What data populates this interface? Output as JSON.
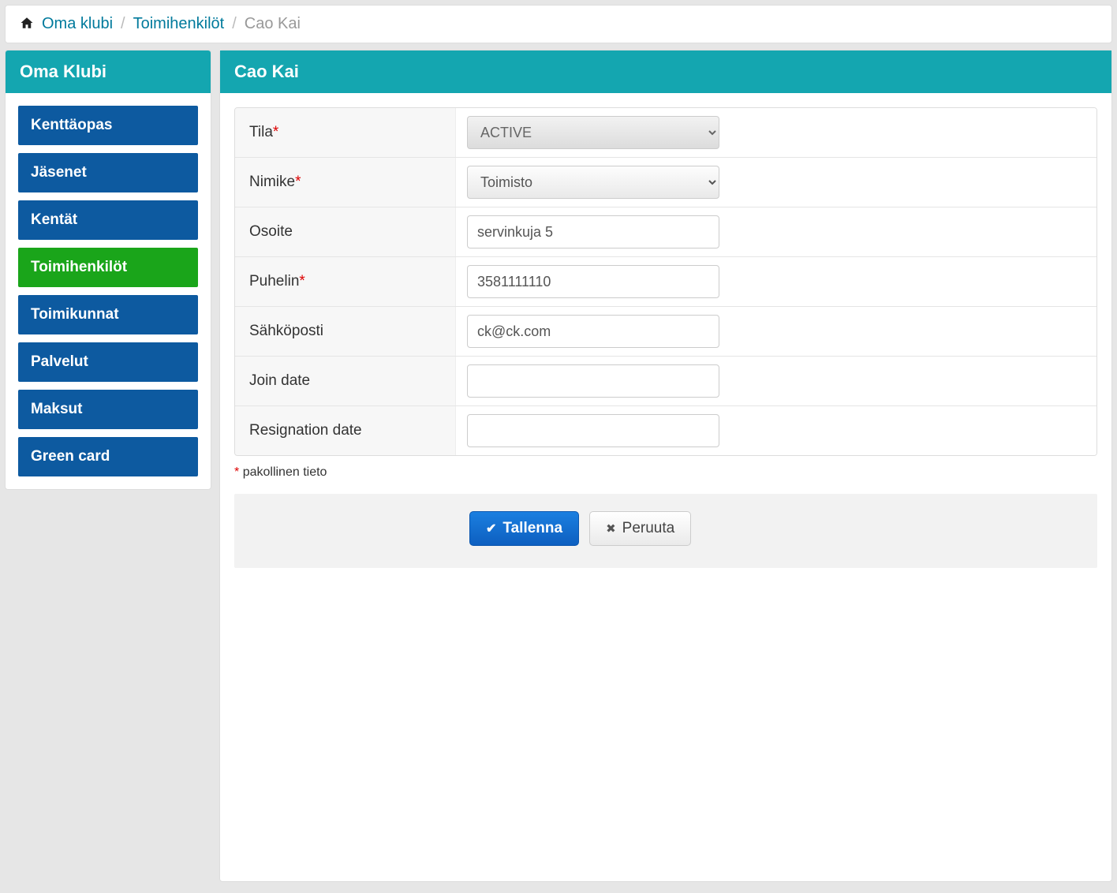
{
  "breadcrumb": {
    "items": [
      {
        "label": "Oma klubi",
        "link": true
      },
      {
        "label": "Toimihenkilöt",
        "link": true
      },
      {
        "label": "Cao Kai",
        "link": false
      }
    ]
  },
  "sidebar": {
    "title": "Oma Klubi",
    "items": [
      {
        "label": "Kenttäopas",
        "active": false
      },
      {
        "label": "Jäsenet",
        "active": false
      },
      {
        "label": "Kentät",
        "active": false
      },
      {
        "label": "Toimihenkilöt",
        "active": true
      },
      {
        "label": "Toimikunnat",
        "active": false
      },
      {
        "label": "Palvelut",
        "active": false
      },
      {
        "label": "Maksut",
        "active": false
      },
      {
        "label": "Green card",
        "active": false
      }
    ]
  },
  "main": {
    "title": "Cao Kai",
    "fields": {
      "status": {
        "label": "Tila",
        "required": true,
        "value": "ACTIVE"
      },
      "title": {
        "label": "Nimike",
        "required": true,
        "value": "Toimisto"
      },
      "address": {
        "label": "Osoite",
        "required": false,
        "value": "servinkuja 5"
      },
      "phone": {
        "label": "Puhelin",
        "required": true,
        "value": "3581111110"
      },
      "email": {
        "label": "Sähköposti",
        "required": false,
        "value": "ck@ck.com"
      },
      "join": {
        "label": "Join date",
        "required": false,
        "value": ""
      },
      "resign": {
        "label": "Resignation date",
        "required": false,
        "value": ""
      }
    },
    "hint": "pakollinen tieto",
    "buttons": {
      "save": "Tallenna",
      "cancel": "Peruuta"
    }
  }
}
